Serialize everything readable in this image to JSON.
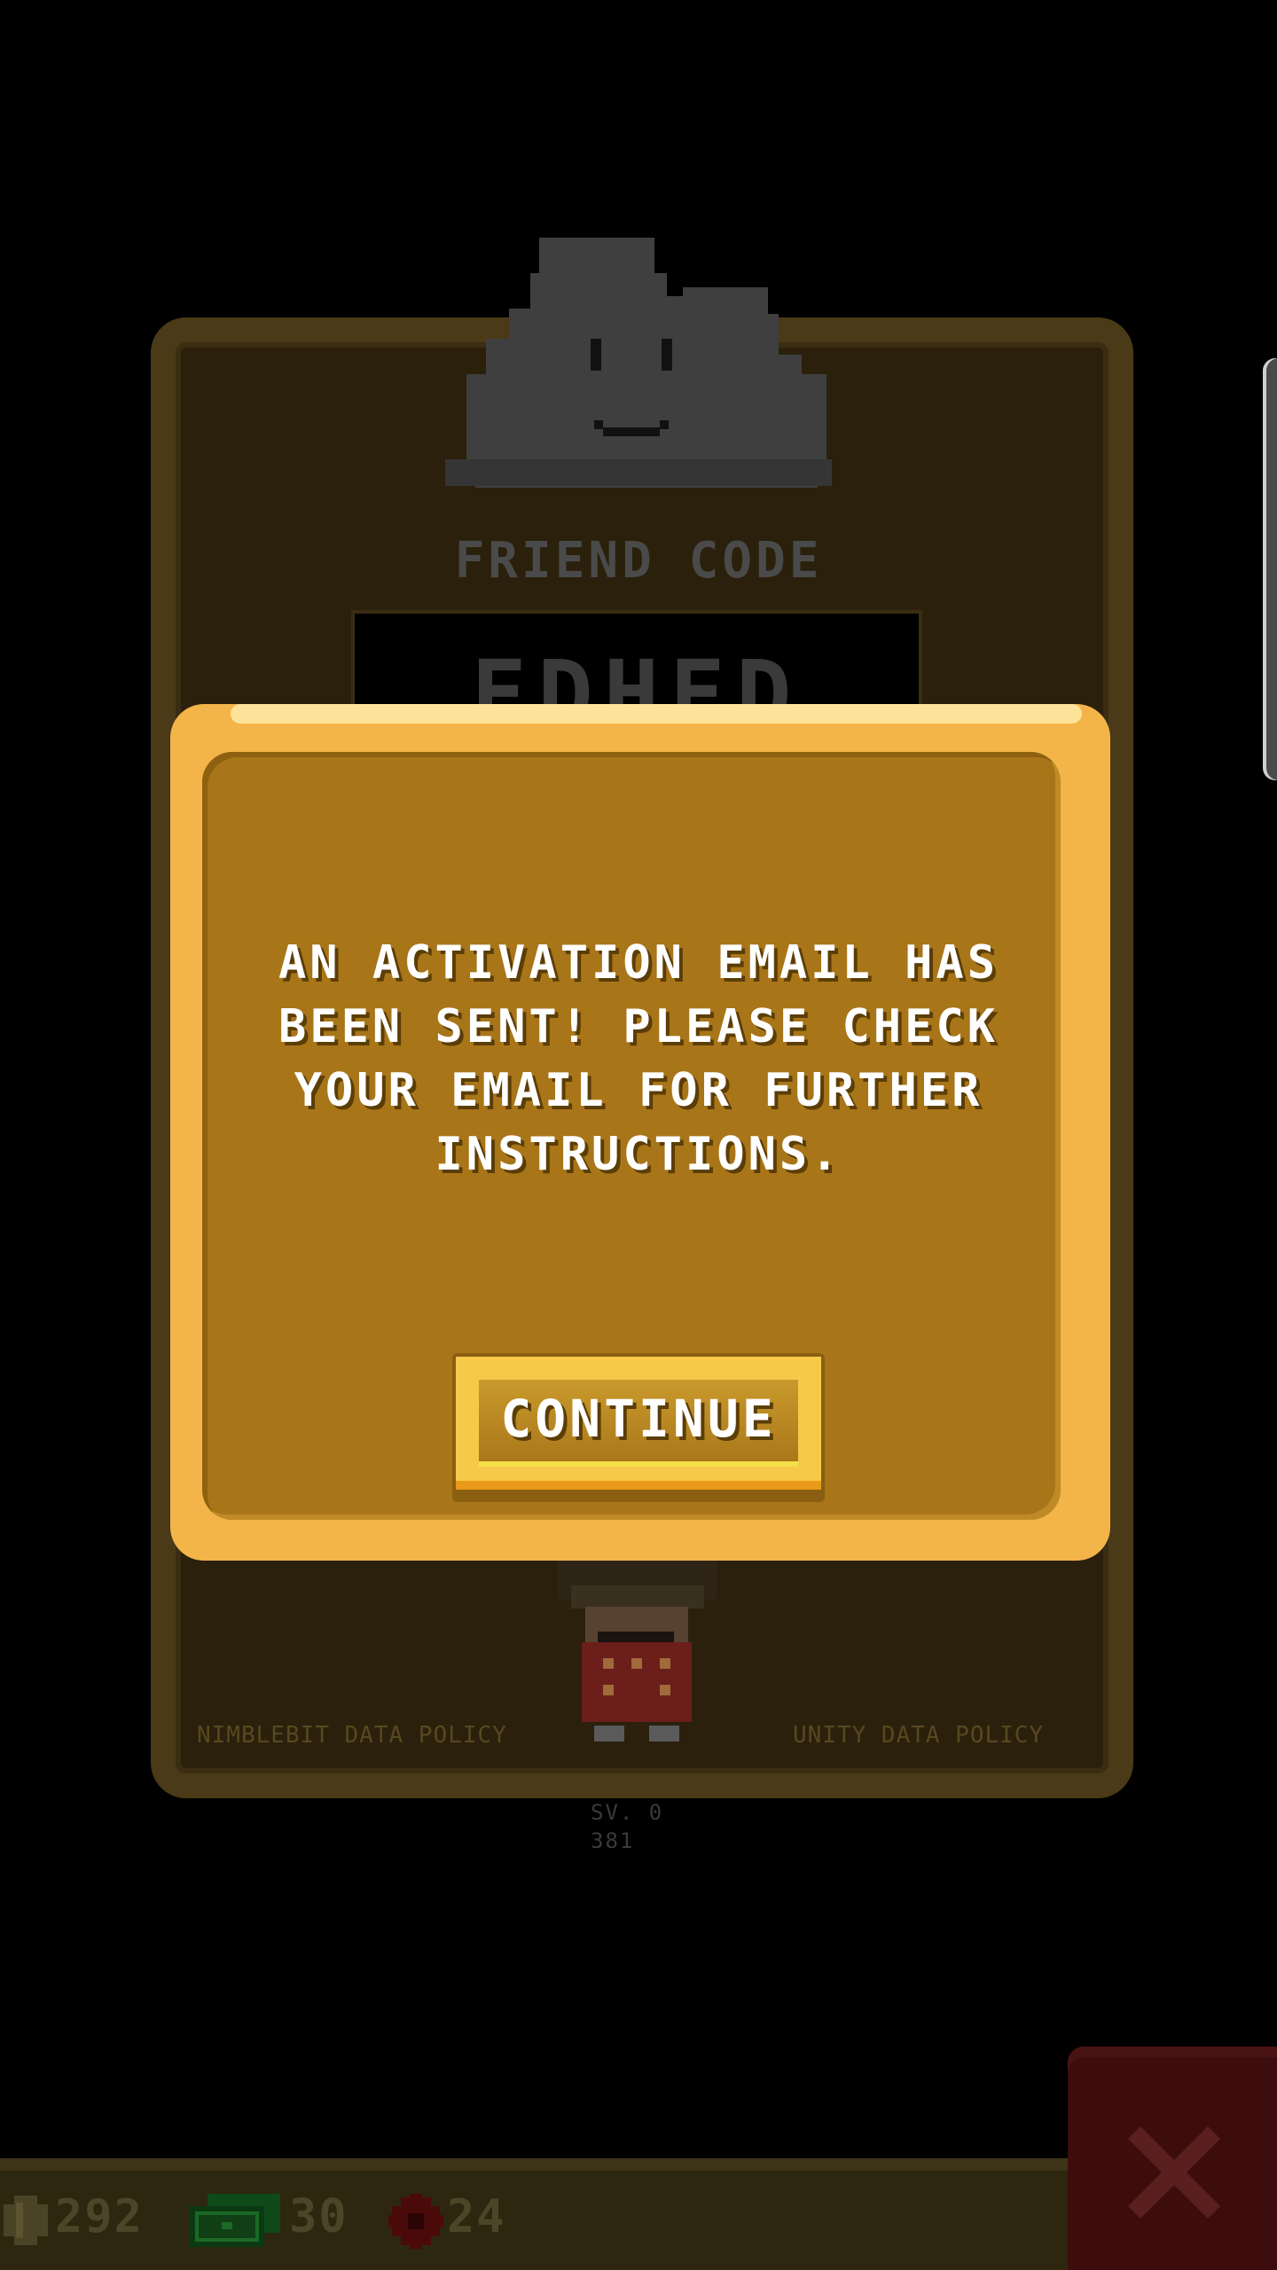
{
  "friend_panel": {
    "label": "FRIEND CODE",
    "code_visible": "EDHED",
    "nimblebit_policy": "NIMBLEBIT DATA POLICY",
    "unity_policy": "UNITY DATA POLICY",
    "version_line1": "SV. 0",
    "version_line2": "381",
    "cloud_icon": "cloud-smiley-icon"
  },
  "modal": {
    "message": "AN ACTIVATION EMAIL HAS BEEN SENT! PLEASE CHECK YOUR EMAIL FOR FURTHER INSTRUCTIONS.",
    "continue_label": "CONTINUE"
  },
  "hud": {
    "coins": "292",
    "bux": "30",
    "gears": "24",
    "icons": [
      "coin-icon",
      "bux-icon",
      "gear-icon",
      "close-icon"
    ]
  },
  "colors": {
    "modal_border": "#f3b54a",
    "modal_fill": "#a87519",
    "panel_fill": "#2a200c",
    "close_button": "#3d0d0d"
  }
}
